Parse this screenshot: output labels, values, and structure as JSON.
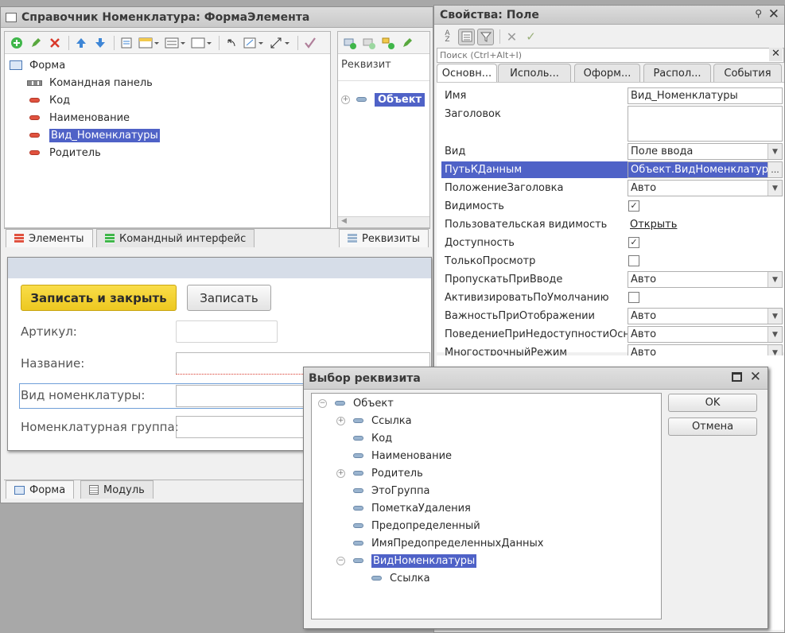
{
  "form_window": {
    "title": "Справочник Номенклатура: ФормаЭлемента",
    "tree": [
      {
        "label": "Форма",
        "icon": "form-icon"
      },
      {
        "label": "Командная панель",
        "icon": "command-panel-icon"
      },
      {
        "label": "Код",
        "icon": "field-icon"
      },
      {
        "label": "Наименование",
        "icon": "field-icon"
      },
      {
        "label": "Вид_Номенклатуры",
        "icon": "field-icon",
        "selected": true
      },
      {
        "label": "Родитель",
        "icon": "field-icon"
      }
    ],
    "bottom_tabs": [
      "Элементы",
      "Командный интерфейс"
    ],
    "requisites": {
      "header": "Реквизит",
      "items": [
        {
          "label": "Объект"
        }
      ],
      "tab": "Реквизиты"
    },
    "preview": {
      "save_close": "Записать и закрыть",
      "save": "Записать",
      "fields": [
        "Артикул:",
        "Название:",
        "Вид номенклатуры:",
        "Номенклатурная группа:"
      ]
    },
    "footer_tabs": [
      "Форма",
      "Модуль"
    ]
  },
  "props_window": {
    "title": "Свойства: Поле",
    "search_placeholder": "Поиск (Ctrl+Alt+I)",
    "tabs": [
      "Основн...",
      "Исполь...",
      "Оформ...",
      "Распол...",
      "События"
    ],
    "rows": [
      {
        "name": "Имя",
        "value": "Вид_Номенклатуры",
        "kind": "text"
      },
      {
        "name": "Заголовок",
        "value": "",
        "kind": "textarea"
      },
      {
        "name": "Вид",
        "value": "Поле ввода",
        "kind": "dropdown"
      },
      {
        "name": "ПутьКДанным",
        "value": "Объект.ВидНоменклатуры",
        "kind": "ellipsis",
        "selected": true
      },
      {
        "name": "ПоложениеЗаголовка",
        "value": "Авто",
        "kind": "dropdown"
      },
      {
        "name": "Видимость",
        "value": "✓",
        "kind": "check"
      },
      {
        "name": "Пользовательская видимость",
        "value": "Открыть",
        "kind": "link"
      },
      {
        "name": "Доступность",
        "value": "✓",
        "kind": "check"
      },
      {
        "name": "ТолькоПросмотр",
        "value": "",
        "kind": "check"
      },
      {
        "name": "ПропускатьПриВводе",
        "value": "Авто",
        "kind": "dropdown"
      },
      {
        "name": "АктивизироватьПоУмолчанию",
        "value": "",
        "kind": "check"
      },
      {
        "name": "ВажностьПриОтображении",
        "value": "Авто",
        "kind": "dropdown"
      },
      {
        "name": "ПоведениеПриНедоступностиОсн",
        "value": "Авто",
        "kind": "dropdown"
      },
      {
        "name": "МногострочныйРежим",
        "value": "Авто",
        "kind": "dropdown"
      }
    ]
  },
  "dialog": {
    "title": "Выбор реквизита",
    "ok": "OK",
    "cancel": "Отмена",
    "tree": [
      {
        "label": "Объект",
        "level": 0,
        "toggle": "minus"
      },
      {
        "label": "Ссылка",
        "level": 1,
        "toggle": "plus"
      },
      {
        "label": "Код",
        "level": 1,
        "toggle": ""
      },
      {
        "label": "Наименование",
        "level": 1,
        "toggle": ""
      },
      {
        "label": "Родитель",
        "level": 1,
        "toggle": "plus"
      },
      {
        "label": "ЭтоГруппа",
        "level": 1,
        "toggle": ""
      },
      {
        "label": "ПометкаУдаления",
        "level": 1,
        "toggle": ""
      },
      {
        "label": "Предопределенный",
        "level": 1,
        "toggle": ""
      },
      {
        "label": "ИмяПредопределенныхДанных",
        "level": 1,
        "toggle": ""
      },
      {
        "label": "ВидНоменклатуры",
        "level": 1,
        "toggle": "minus",
        "selected": true
      },
      {
        "label": "Ссылка",
        "level": 2,
        "toggle": ""
      }
    ]
  },
  "colors": {
    "accent": "#4f62c7",
    "save_button": "#f5d43a",
    "titlebar": "#d3d3d3"
  }
}
